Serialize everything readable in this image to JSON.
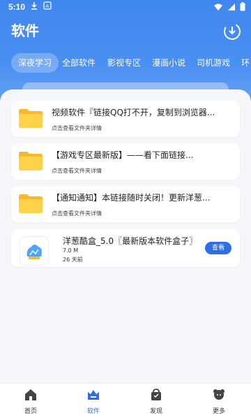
{
  "status_bar": {
    "time": "5:10"
  },
  "header": {
    "title": "软件"
  },
  "tabs": [
    {
      "label": "深夜学习",
      "active": true
    },
    {
      "label": "全部软件",
      "active": false
    },
    {
      "label": "影视专区",
      "active": false
    },
    {
      "label": "漫画小说",
      "active": false
    },
    {
      "label": "司机游戏",
      "active": false
    },
    {
      "label": "环",
      "active": false
    }
  ],
  "folders": [
    {
      "title": "视频软件『链接QQ打不开，复制到浏览器...",
      "subtitle": "点击查看文件夹详情"
    },
    {
      "title": "【游戏专区最新版】——看下面链接...",
      "subtitle": "点击查看文件夹详情"
    },
    {
      "title": "【通知通知】本链接随时关闭！更新洋葱...",
      "subtitle": "点击查看文件夹详情"
    }
  ],
  "app": {
    "title": "洋葱酷盒_5.0〖最新版本软件盒子〗",
    "size": "7.0 M",
    "time": "26 天前",
    "button": "查看"
  },
  "bottom_nav": [
    {
      "label": "首页",
      "icon": "home-icon",
      "active": false
    },
    {
      "label": "软件",
      "icon": "software-icon",
      "active": true
    },
    {
      "label": "发现",
      "icon": "discover-icon",
      "active": false
    },
    {
      "label": "更多",
      "icon": "more-icon",
      "active": false
    }
  ],
  "colors": {
    "primary": "#3f86ee",
    "accent_button": "#2d6fe0",
    "folder": "#ffcc33"
  }
}
